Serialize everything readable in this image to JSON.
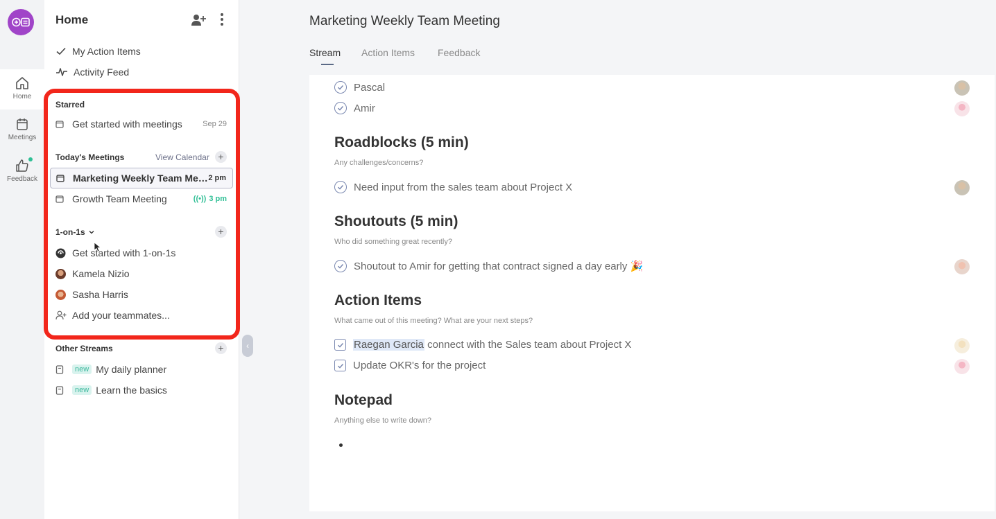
{
  "rail": {
    "items": [
      {
        "label": "Home",
        "icon": "home-icon"
      },
      {
        "label": "Meetings",
        "icon": "calendar-icon"
      },
      {
        "label": "Feedback",
        "icon": "thumbs-up-icon"
      }
    ]
  },
  "sidebar": {
    "title": "Home",
    "nav": [
      {
        "label": "My Action Items",
        "icon": "check-icon"
      },
      {
        "label": "Activity Feed",
        "icon": "activity-icon"
      }
    ],
    "starred": {
      "heading": "Starred",
      "items": [
        {
          "label": "Get started with meetings",
          "meta": "Sep 29"
        }
      ]
    },
    "today": {
      "heading": "Today's Meetings",
      "link": "View Calendar",
      "items": [
        {
          "label": "Marketing Weekly Team Meeting",
          "meta": "2 pm"
        },
        {
          "label": "Growth Team Meeting",
          "meta": "3 pm",
          "live_icon": "((•))"
        }
      ]
    },
    "one_on_ones": {
      "heading": "1-on-1s",
      "items": [
        {
          "label": "Get started with 1-on-1s"
        },
        {
          "label": "Kamela Nizio"
        },
        {
          "label": "Sasha Harris"
        },
        {
          "label": "Add your teammates..."
        }
      ]
    },
    "other_streams": {
      "heading": "Other Streams",
      "badge": "new",
      "items": [
        {
          "label": "My daily planner"
        },
        {
          "label": "Learn the basics"
        }
      ]
    },
    "collapse_glyph": "‹"
  },
  "main": {
    "title": "Marketing Weekly Team Meeting",
    "tabs": [
      {
        "label": "Stream",
        "active": true
      },
      {
        "label": "Action Items",
        "active": false
      },
      {
        "label": "Feedback",
        "active": false
      }
    ],
    "attendees": [
      "Pascal",
      "Amir"
    ],
    "sections": [
      {
        "title": "Roadblocks (5 min)",
        "subtitle": "Any challenges/concerns?",
        "items": [
          "Need input from the sales team about Project X"
        ]
      },
      {
        "title": "Shoutouts (5 min)",
        "subtitle": "Who did something great recently?",
        "items": [
          "Shoutout to Amir for getting that contract signed a day early 🎉"
        ]
      },
      {
        "title": "Action Items",
        "subtitle": "What came out of this meeting? What are your next steps?",
        "items": [
          {
            "mention": "Raegan Garcia",
            "text": " connect with the Sales team about Project X"
          },
          {
            "mention": "",
            "text": "Update OKR's for the project"
          }
        ]
      },
      {
        "title": "Notepad",
        "subtitle": "Anything else to write down?"
      }
    ]
  },
  "colors": {
    "brand": "#a044c8",
    "highlight": "#f2261b",
    "live": "#2fbf95",
    "check": "#7a88b0"
  }
}
